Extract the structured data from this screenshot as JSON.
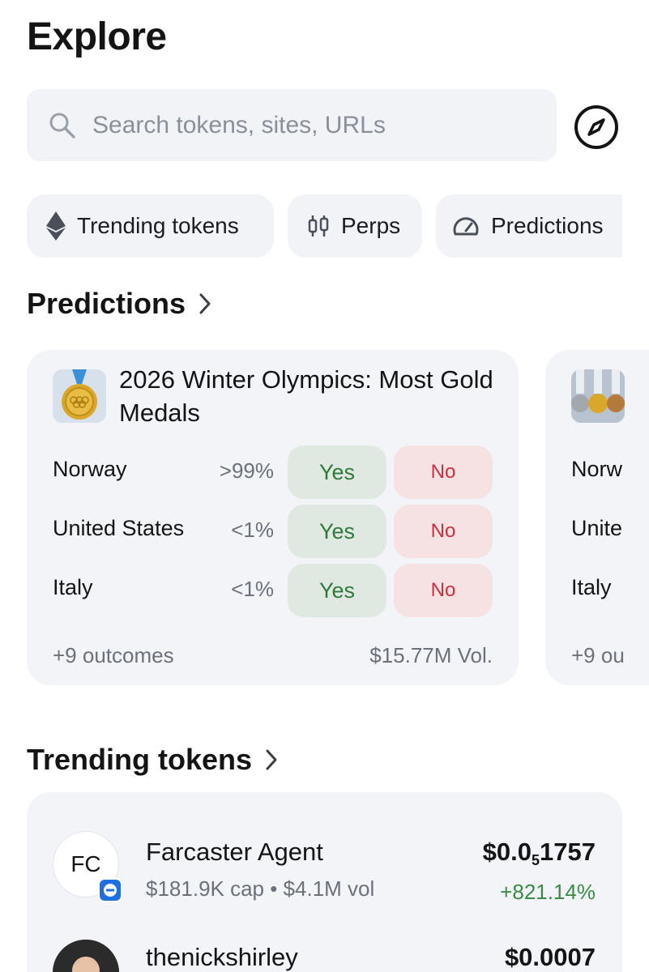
{
  "page": {
    "title": "Explore"
  },
  "search": {
    "placeholder": "Search tokens, sites, URLs"
  },
  "chips": [
    {
      "label": "Trending tokens",
      "icon": "ethereum-icon"
    },
    {
      "label": "Perps",
      "icon": "candlestick-icon"
    },
    {
      "label": "Predictions",
      "icon": "gauge-icon"
    }
  ],
  "predictions": {
    "heading": "Predictions",
    "cards": [
      {
        "title": "2026 Winter Olympics: Most Gold Medals",
        "rows": [
          {
            "name": "Norway",
            "pct": ">99%",
            "yes": "Yes",
            "no": "No"
          },
          {
            "name": "United States",
            "pct": "<1%",
            "yes": "Yes",
            "no": "No"
          },
          {
            "name": "Italy",
            "pct": "<1%",
            "yes": "Yes",
            "no": "No"
          }
        ],
        "outcomes": "+9 outcomes",
        "volume": "$15.77M Vol."
      },
      {
        "rows": [
          "Norw",
          "Unite",
          "Italy"
        ],
        "outcomes": "+9 ou"
      }
    ]
  },
  "trending": {
    "heading": "Trending tokens",
    "tokens": [
      {
        "avatar": "FC",
        "name": "Farcaster Agent",
        "meta": "$181.9K cap • $4.1M vol",
        "price_main": "$0.0",
        "price_sub": "5",
        "price_rest": "1757",
        "change": "+821.14%"
      },
      {
        "name": "thenickshirley",
        "price": "$0.0007"
      }
    ]
  },
  "colors": {
    "yes_bg": "#e0e9e1",
    "yes_text": "#2f7a3b",
    "no_bg": "#f6e1e3",
    "no_text": "#c8313f",
    "positive": "#3b8a45",
    "card_bg": "#f2f4f7"
  }
}
